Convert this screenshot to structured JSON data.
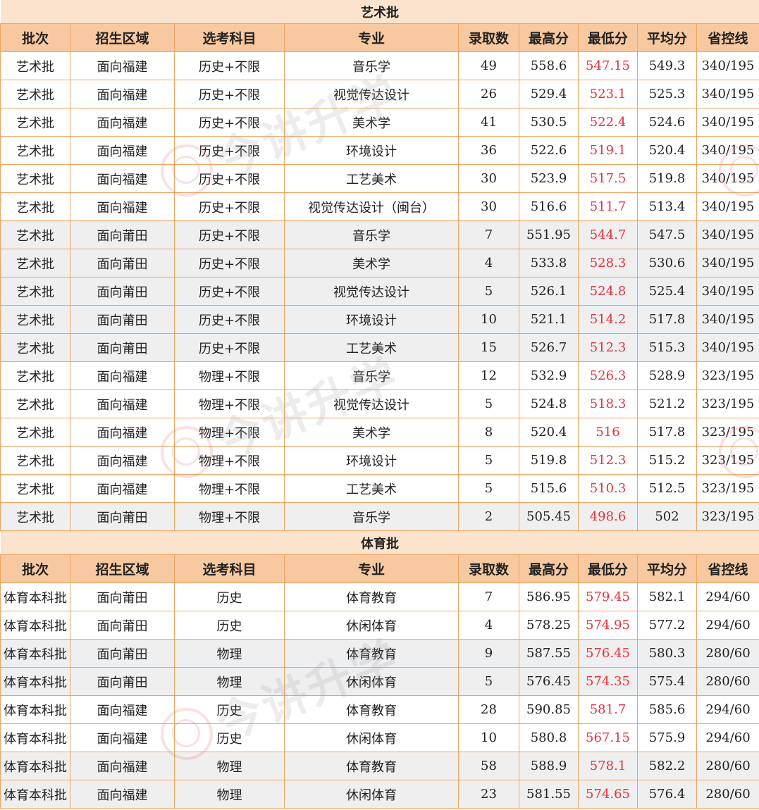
{
  "headers": [
    "批次",
    "招生区域",
    "选考科目",
    "专业",
    "录取数",
    "最高分",
    "最低分",
    "平均分",
    "省控线"
  ],
  "sections": [
    {
      "title": "艺术批",
      "rows": [
        {
          "cells": [
            "艺术批",
            "面向福建",
            "历史+不限",
            "音乐学",
            "49",
            "558.6",
            "547.15",
            "549.3",
            "340/195"
          ],
          "shade": false
        },
        {
          "cells": [
            "艺术批",
            "面向福建",
            "历史+不限",
            "视觉传达设计",
            "26",
            "529.4",
            "523.1",
            "525.3",
            "340/195"
          ],
          "shade": false
        },
        {
          "cells": [
            "艺术批",
            "面向福建",
            "历史+不限",
            "美术学",
            "41",
            "530.5",
            "522.4",
            "524.6",
            "340/195"
          ],
          "shade": false
        },
        {
          "cells": [
            "艺术批",
            "面向福建",
            "历史+不限",
            "环境设计",
            "36",
            "522.6",
            "519.1",
            "520.4",
            "340/195"
          ],
          "shade": false
        },
        {
          "cells": [
            "艺术批",
            "面向福建",
            "历史+不限",
            "工艺美术",
            "30",
            "523.9",
            "517.5",
            "519.8",
            "340/195"
          ],
          "shade": false
        },
        {
          "cells": [
            "艺术批",
            "面向福建",
            "历史+不限",
            "视觉传达设计（闽台）",
            "30",
            "516.6",
            "511.7",
            "513.4",
            "340/195"
          ],
          "shade": false
        },
        {
          "cells": [
            "艺术批",
            "面向莆田",
            "历史+不限",
            "音乐学",
            "7",
            "551.95",
            "544.7",
            "547.5",
            "340/195"
          ],
          "shade": true
        },
        {
          "cells": [
            "艺术批",
            "面向莆田",
            "历史+不限",
            "美术学",
            "4",
            "533.8",
            "528.3",
            "530.6",
            "340/195"
          ],
          "shade": true
        },
        {
          "cells": [
            "艺术批",
            "面向莆田",
            "历史+不限",
            "视觉传达设计",
            "5",
            "526.1",
            "524.8",
            "525.4",
            "340/195"
          ],
          "shade": true
        },
        {
          "cells": [
            "艺术批",
            "面向莆田",
            "历史+不限",
            "环境设计",
            "10",
            "521.1",
            "514.2",
            "517.8",
            "340/195"
          ],
          "shade": true
        },
        {
          "cells": [
            "艺术批",
            "面向莆田",
            "历史+不限",
            "工艺美术",
            "15",
            "526.7",
            "512.3",
            "515.3",
            "340/195"
          ],
          "shade": true
        },
        {
          "cells": [
            "艺术批",
            "面向福建",
            "物理+不限",
            "音乐学",
            "12",
            "532.9",
            "526.3",
            "528.9",
            "323/195"
          ],
          "shade": false
        },
        {
          "cells": [
            "艺术批",
            "面向福建",
            "物理+不限",
            "视觉传达设计",
            "5",
            "524.8",
            "518.3",
            "521.2",
            "323/195"
          ],
          "shade": false
        },
        {
          "cells": [
            "艺术批",
            "面向福建",
            "物理+不限",
            "美术学",
            "8",
            "520.4",
            "516",
            "517.8",
            "323/195"
          ],
          "shade": false
        },
        {
          "cells": [
            "艺术批",
            "面向福建",
            "物理+不限",
            "环境设计",
            "5",
            "519.8",
            "512.3",
            "515.2",
            "323/195"
          ],
          "shade": false
        },
        {
          "cells": [
            "艺术批",
            "面向福建",
            "物理+不限",
            "工艺美术",
            "5",
            "515.6",
            "510.3",
            "512.5",
            "323/195"
          ],
          "shade": false
        },
        {
          "cells": [
            "艺术批",
            "面向莆田",
            "物理+不限",
            "音乐学",
            "2",
            "505.45",
            "498.6",
            "502",
            "323/195"
          ],
          "shade": true
        }
      ]
    },
    {
      "title": "体育批",
      "rows": [
        {
          "cells": [
            "体育本科批",
            "面向莆田",
            "历史",
            "体育教育",
            "7",
            "586.95",
            "579.45",
            "582.1",
            "294/60"
          ],
          "shade": false
        },
        {
          "cells": [
            "体育本科批",
            "面向莆田",
            "历史",
            "休闲体育",
            "4",
            "578.25",
            "574.95",
            "577.2",
            "294/60"
          ],
          "shade": false
        },
        {
          "cells": [
            "体育本科批",
            "面向莆田",
            "物理",
            "体育教育",
            "9",
            "587.55",
            "576.45",
            "580.3",
            "280/60"
          ],
          "shade": true
        },
        {
          "cells": [
            "体育本科批",
            "面向莆田",
            "物理",
            "休闲体育",
            "5",
            "576.45",
            "574.35",
            "575.4",
            "280/60"
          ],
          "shade": true
        },
        {
          "cells": [
            "体育本科批",
            "面向福建",
            "历史",
            "体育教育",
            "28",
            "590.85",
            "581.7",
            "585.6",
            "294/60"
          ],
          "shade": false
        },
        {
          "cells": [
            "体育本科批",
            "面向福建",
            "历史",
            "休闲体育",
            "10",
            "580.8",
            "567.15",
            "575.9",
            "294/60"
          ],
          "shade": false
        },
        {
          "cells": [
            "体育本科批",
            "面向福建",
            "物理",
            "体育教育",
            "58",
            "588.9",
            "578.1",
            "582.2",
            "280/60"
          ],
          "shade": true
        },
        {
          "cells": [
            "体育本科批",
            "面向福建",
            "物理",
            "休闲体育",
            "23",
            "581.55",
            "574.65",
            "576.4",
            "280/60"
          ],
          "shade": true
        }
      ]
    }
  ],
  "watermark": "今讲升学"
}
